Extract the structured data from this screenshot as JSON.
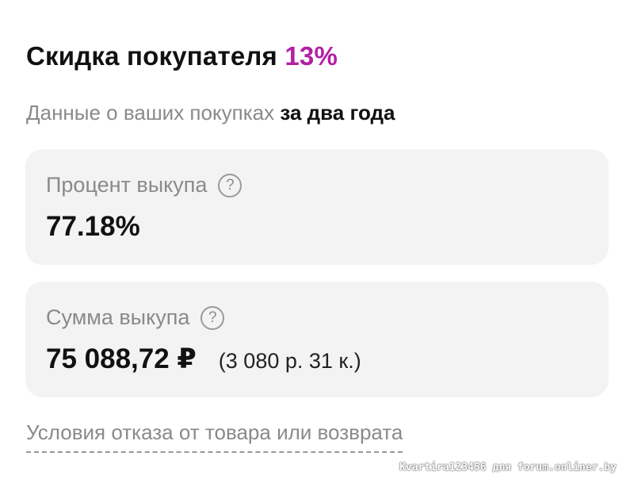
{
  "header": {
    "title": "Скидка покупателя",
    "discount_percent": "13%"
  },
  "subtitle": {
    "text": "Данные о ваших покупках",
    "period": "за два года"
  },
  "cards": [
    {
      "label": "Процент выкупа",
      "help_icon": "?",
      "value": "77.18%",
      "secondary": ""
    },
    {
      "label": "Сумма выкупа",
      "help_icon": "?",
      "value": "75 088,72 ₽",
      "secondary": "(3 080 р. 31 к.)"
    }
  ],
  "footer": {
    "conditions_link": "Условия отказа от товара или возврата"
  },
  "watermark": "Kvartira123456 для forum.onliner.by",
  "colors": {
    "accent": "#b21fa5",
    "card_bg": "#f3f3f3",
    "muted_text": "#8a8a8a",
    "primary_text": "#111111"
  }
}
